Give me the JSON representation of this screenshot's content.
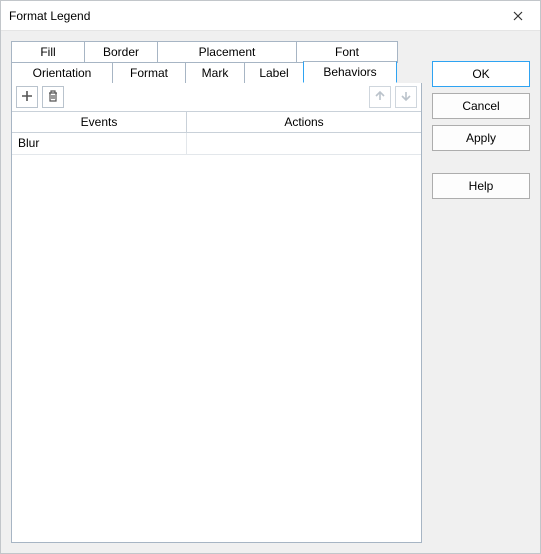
{
  "window": {
    "title": "Format Legend"
  },
  "tabs": {
    "row1": [
      {
        "label": "Fill"
      },
      {
        "label": "Border"
      },
      {
        "label": "Placement"
      },
      {
        "label": "Font"
      }
    ],
    "row2": [
      {
        "label": "Orientation"
      },
      {
        "label": "Format"
      },
      {
        "label": "Mark"
      },
      {
        "label": "Label"
      },
      {
        "label": "Behaviors"
      }
    ],
    "active": "Behaviors"
  },
  "toolbar": {
    "add": "add-icon",
    "delete": "delete-icon",
    "moveUp": "arrow-up-icon",
    "moveDown": "arrow-down-icon"
  },
  "table": {
    "columns": {
      "events": "Events",
      "actions": "Actions"
    },
    "rows": [
      {
        "event": "Blur",
        "action": ""
      }
    ]
  },
  "buttons": {
    "ok": "OK",
    "cancel": "Cancel",
    "apply": "Apply",
    "help": "Help"
  }
}
